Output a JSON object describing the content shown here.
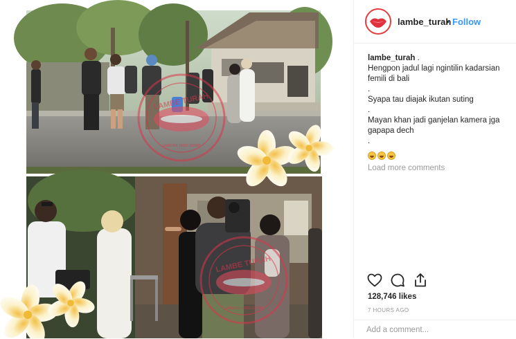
{
  "post": {
    "username": "lambe_turah",
    "separator": "•",
    "follow_label": "Follow",
    "caption_username": "lambe_turah",
    "caption_username_suffix": " .",
    "caption_lines": [
      "Hengpon jadul lagi ngintilin kadarsian femili di bali",
      ".",
      "Syapa tau diajak ikutan suting",
      ".",
      "Mayan khan jadi ganjelan kamera jga gapapa dech",
      "."
    ],
    "emoji": [
      "grinning-sweat-emoji",
      "grinning-sweat-emoji",
      "grinning-sweat-emoji"
    ],
    "load_more_label": "Load more comments",
    "likes_label": "128,746 likes",
    "time_label": "7 HOURS AGO",
    "add_comment_placeholder": "Add a comment..."
  },
  "watermark": {
    "brand": "LAMBE TURAH",
    "tagline": "JANGAN JAGO GOSIP"
  },
  "icons": {
    "like": "heart-icon",
    "comment": "comment-icon",
    "share": "share-icon"
  },
  "colors": {
    "follow": "#3897f0",
    "muted": "#999999",
    "text": "#262626",
    "watermark": "#d9364a",
    "avatar_ring": "#e23d3d"
  }
}
